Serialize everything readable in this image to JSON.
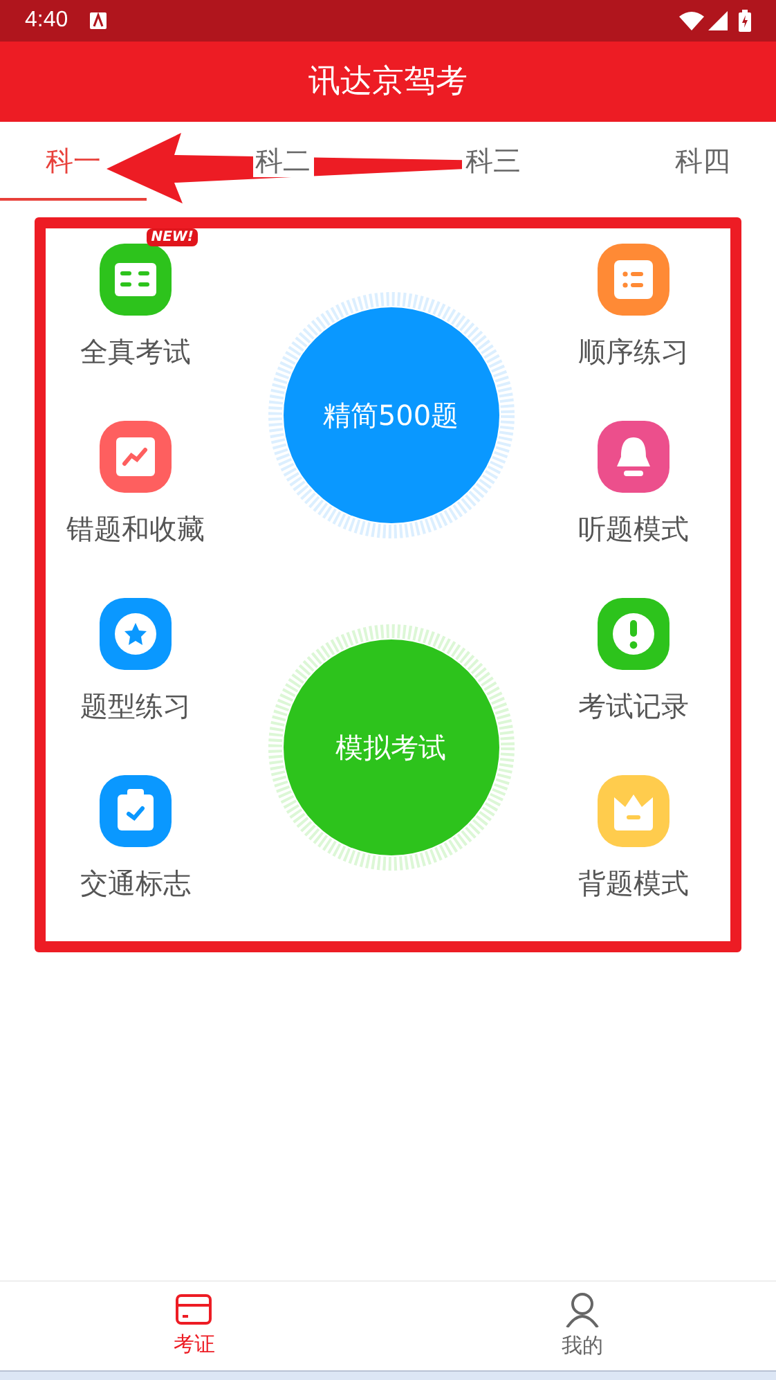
{
  "status_bar": {
    "time": "4:40"
  },
  "header": {
    "title": "讯达京驾考"
  },
  "tabs": [
    {
      "label": "科一",
      "selected": true
    },
    {
      "label": "科二",
      "selected": false
    },
    {
      "label": "科三",
      "selected": false
    },
    {
      "label": "科四",
      "selected": false
    }
  ],
  "left_items": [
    {
      "label": "全真考试",
      "badge": "NEW!"
    },
    {
      "label": "错题和收藏"
    },
    {
      "label": "题型练习"
    },
    {
      "label": "交通标志"
    }
  ],
  "center_buttons": [
    {
      "label": "精简500题"
    },
    {
      "label": "模拟考试"
    }
  ],
  "right_items": [
    {
      "label": "顺序练习"
    },
    {
      "label": "听题模式"
    },
    {
      "label": "考试记录"
    },
    {
      "label": "背题模式"
    }
  ],
  "bottom_nav": [
    {
      "label": "考证",
      "selected": true
    },
    {
      "label": "我的",
      "selected": false
    }
  ]
}
